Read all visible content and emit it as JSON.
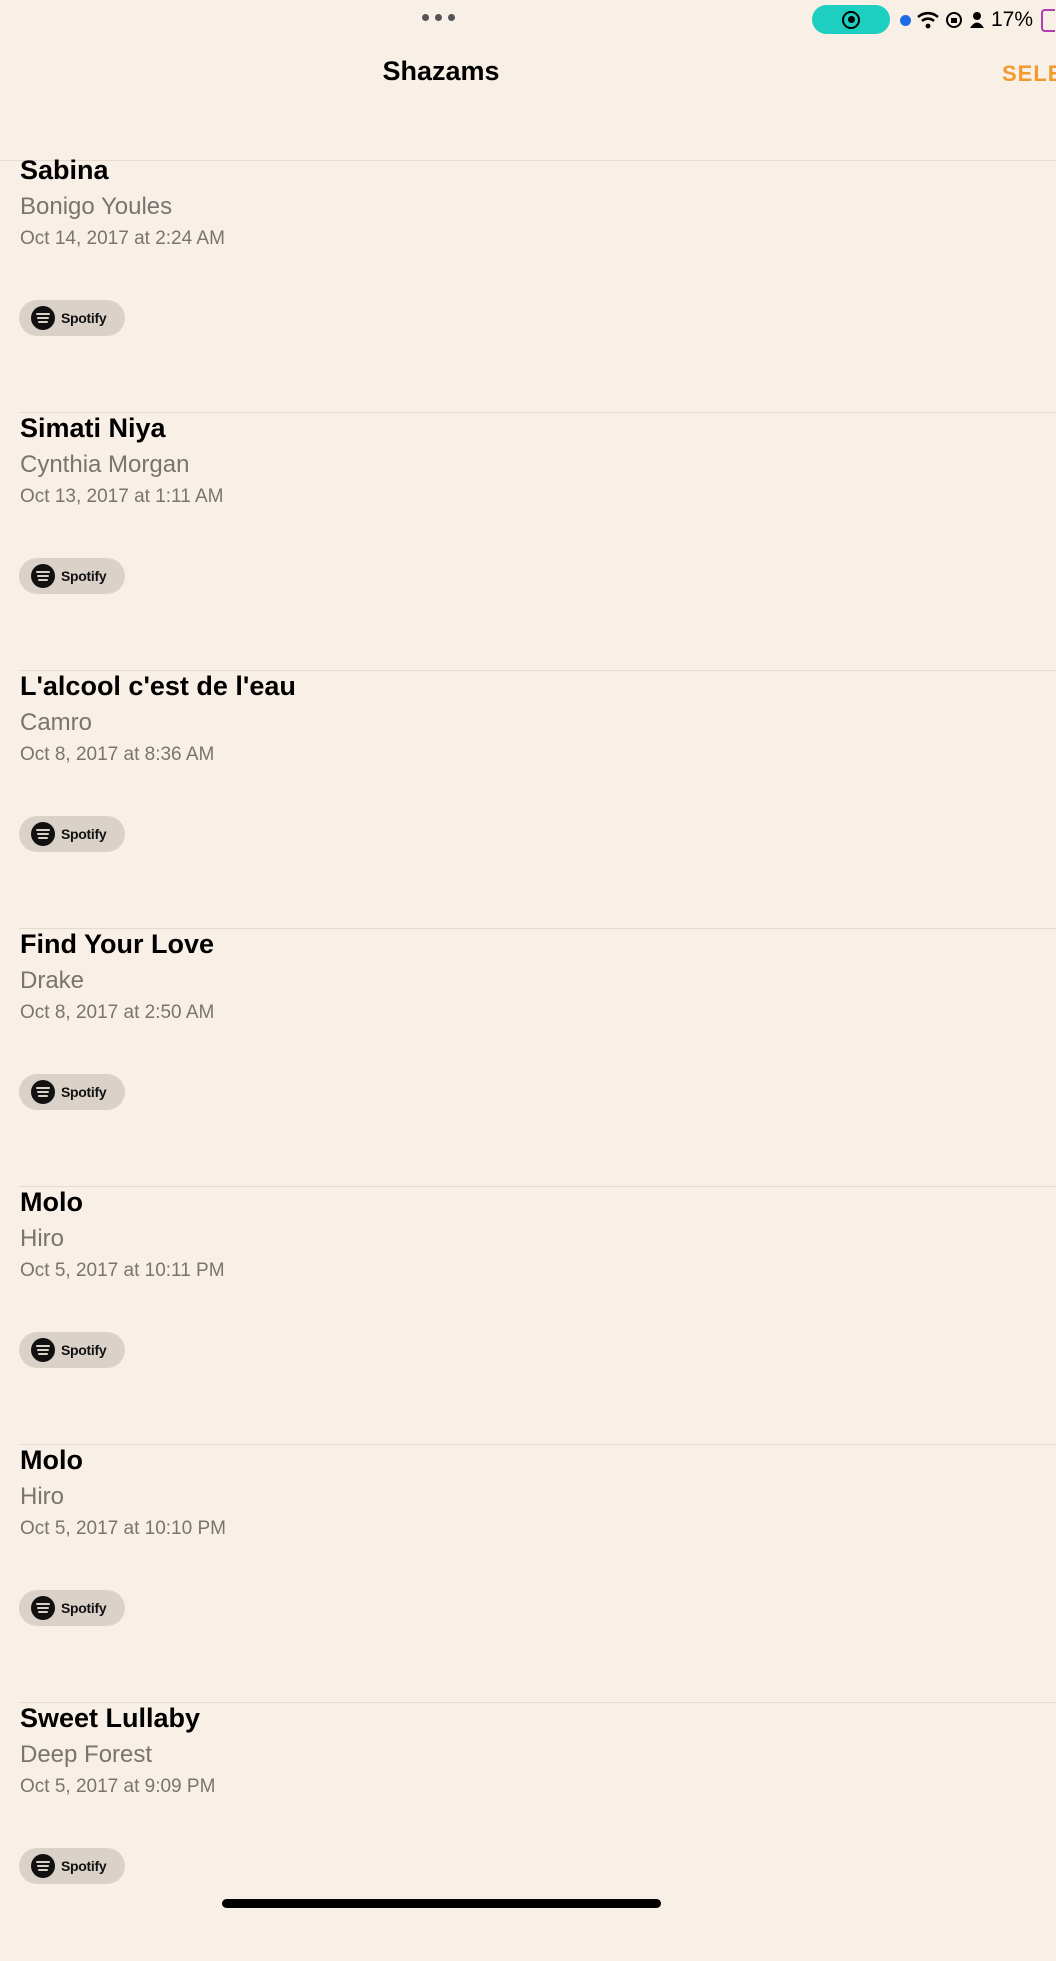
{
  "status_bar": {
    "battery_percent": "17%",
    "record_indicator_color": "#1ccfc0"
  },
  "nav": {
    "title": "Shazams",
    "select_label": "SELECT"
  },
  "accent_color": "#f19a2e",
  "items": [
    {
      "title": "Sabina",
      "artist": "Bonigo Youles",
      "date": "Oct 14, 2017 at 2:24 AM",
      "service": "Spotify"
    },
    {
      "title": "Simati Niya",
      "artist": "Cynthia Morgan",
      "date": "Oct 13, 2017 at 1:11 AM",
      "service": "Spotify"
    },
    {
      "title": "L'alcool c'est de l'eau",
      "artist": "Camro",
      "date": "Oct 8, 2017 at 8:36 AM",
      "service": "Spotify"
    },
    {
      "title": "Find Your Love",
      "artist": "Drake",
      "date": "Oct 8, 2017 at 2:50 AM",
      "service": "Spotify"
    },
    {
      "title": "Molo",
      "artist": "Hiro",
      "date": "Oct 5, 2017 at 10:11 PM",
      "service": "Spotify"
    },
    {
      "title": "Molo",
      "artist": "Hiro",
      "date": "Oct 5, 2017 at 10:10 PM",
      "service": "Spotify"
    },
    {
      "title": "Sweet Lullaby",
      "artist": "Deep Forest",
      "date": "Oct 5, 2017 at 9:09 PM",
      "service": "Spotify"
    }
  ]
}
